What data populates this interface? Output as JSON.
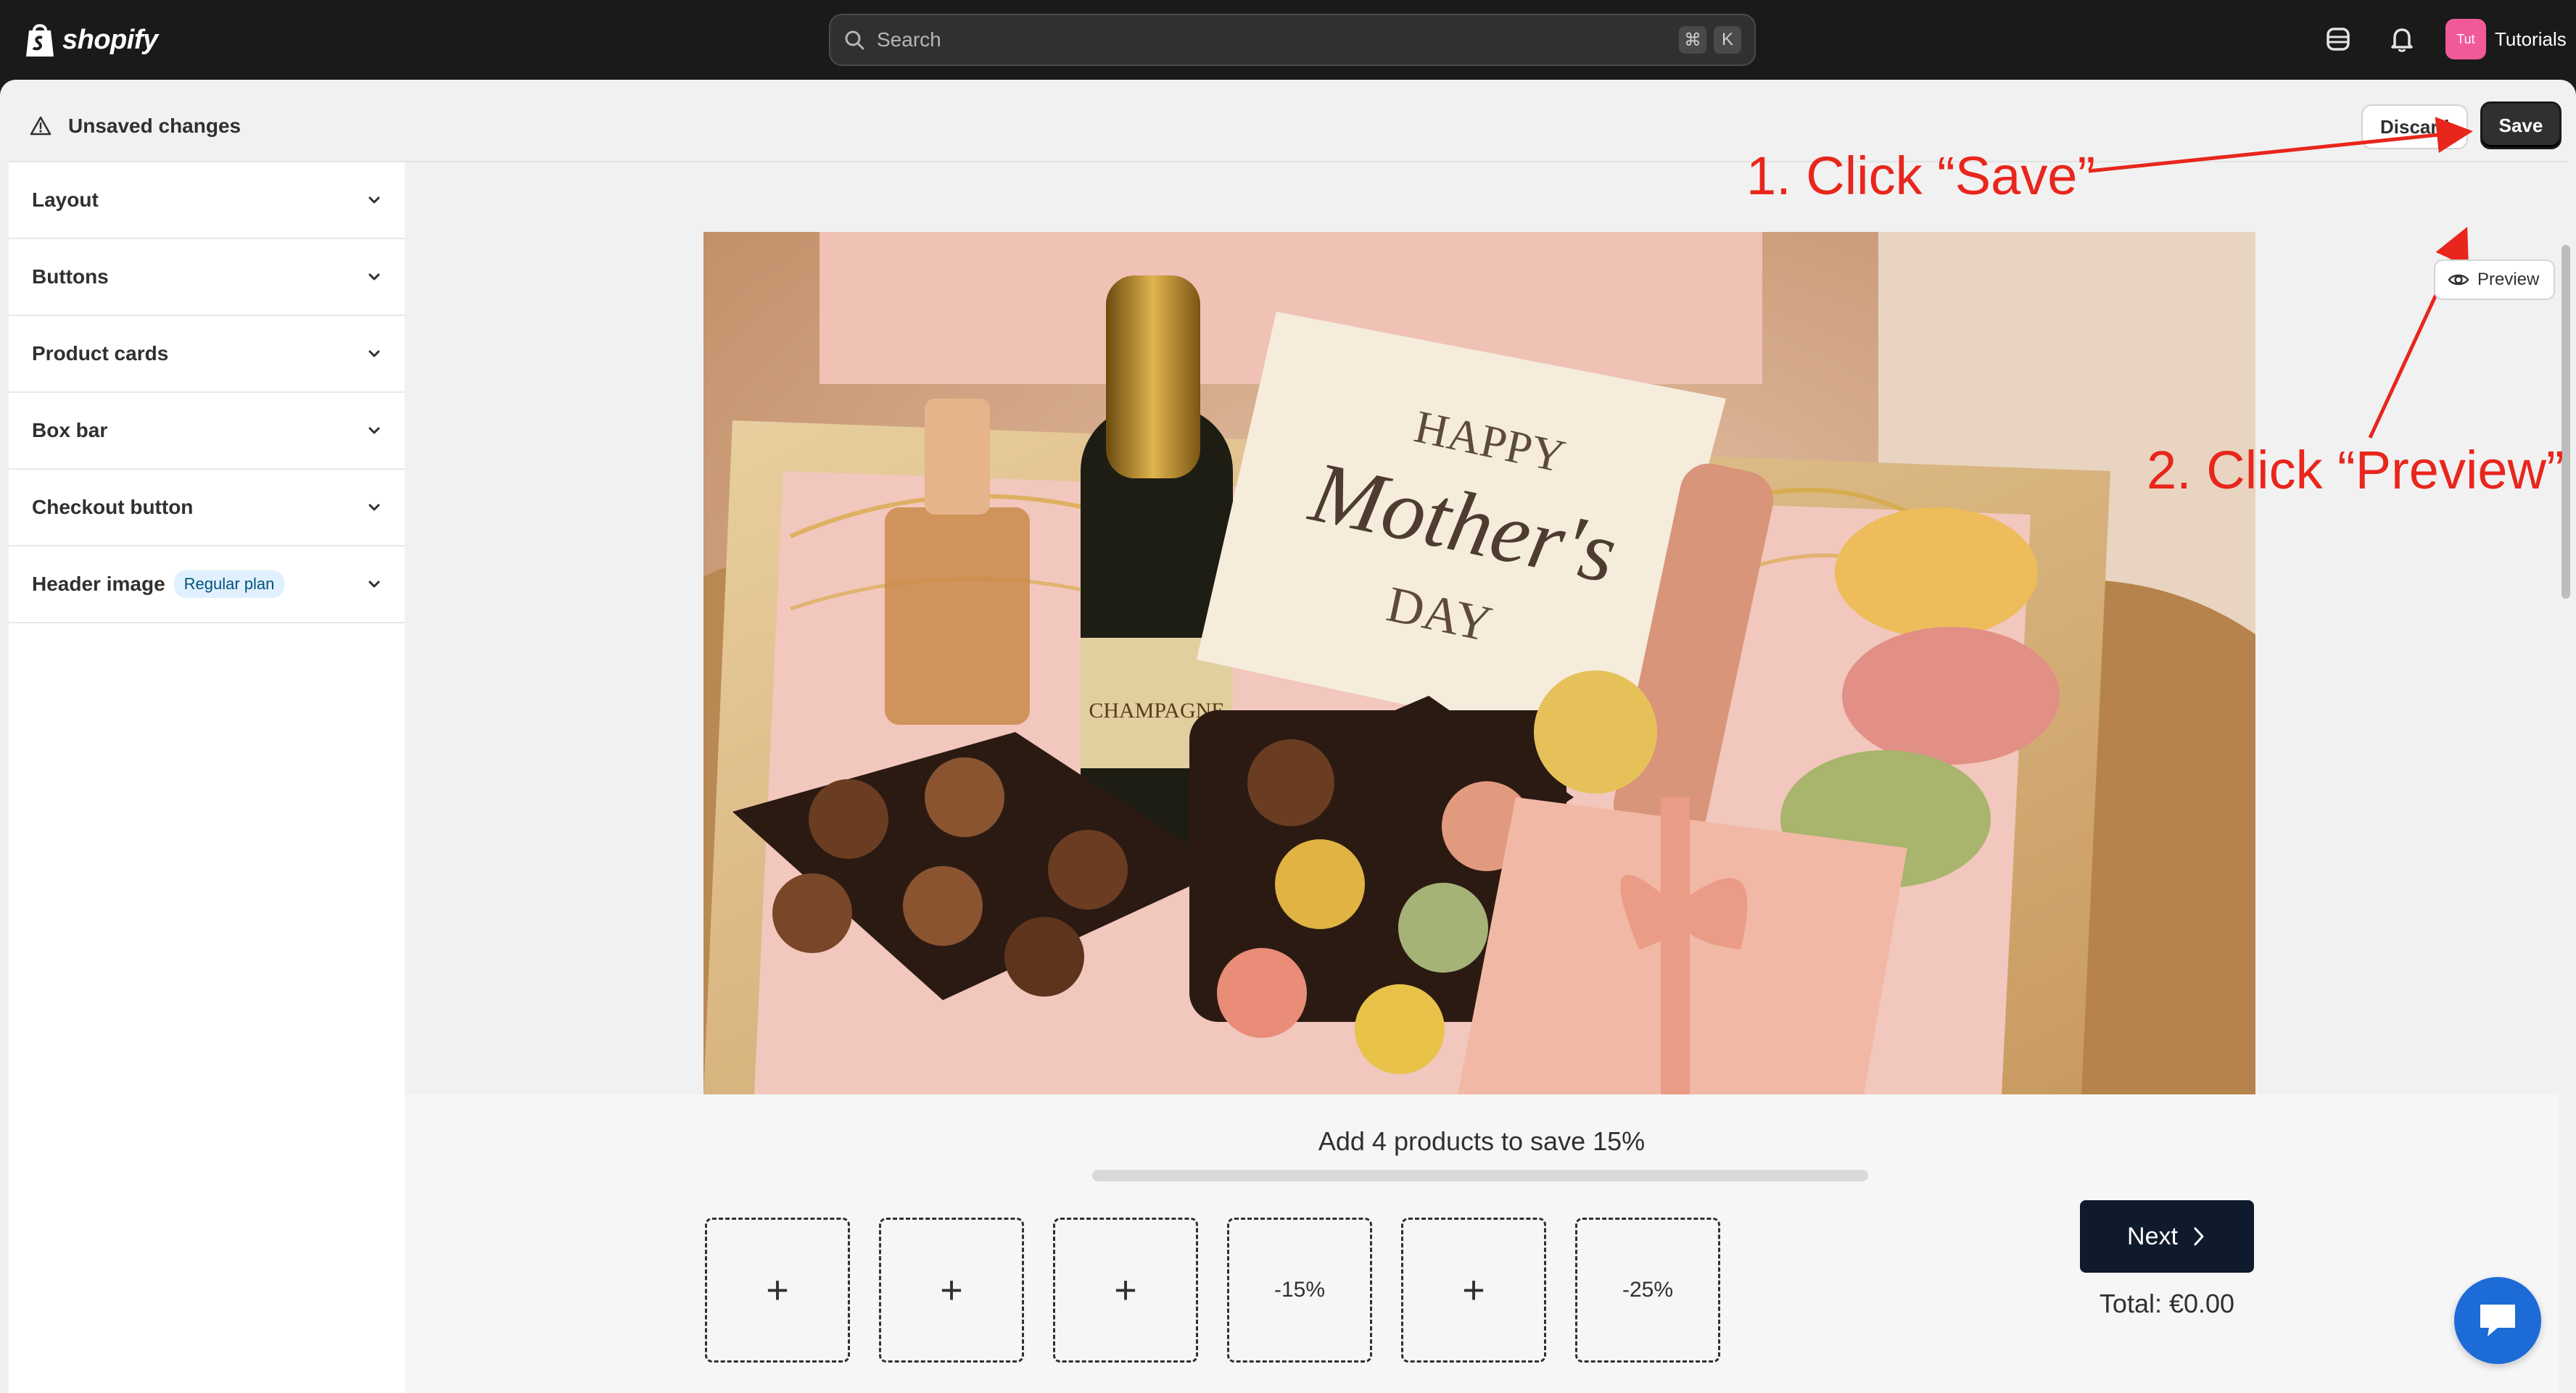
{
  "topbar": {
    "logo_text": "shopify",
    "search_placeholder": "Search",
    "shortcut_keys": [
      "⌘",
      "K"
    ],
    "user_initials": "Tut",
    "user_name": "Tutorials"
  },
  "savebar": {
    "status": "Unsaved changes",
    "discard_label": "Discard",
    "save_label": "Save"
  },
  "sidebar": {
    "items": [
      {
        "label": "Layout"
      },
      {
        "label": "Buttons"
      },
      {
        "label": "Product cards"
      },
      {
        "label": "Box bar"
      },
      {
        "label": "Checkout button"
      },
      {
        "label": "Header image",
        "badge": "Regular plan"
      }
    ]
  },
  "canvas": {
    "preview_label": "Preview",
    "hero_card": {
      "line1": "HAPPY",
      "line2": "Mother's",
      "line3": "DAY",
      "bottle_label": "CHAMPAGNE"
    },
    "progress_text": "Add 4 products to save 15%",
    "progress_fraction": 0.0,
    "slots": [
      "+",
      "+",
      "+",
      "-15%",
      "+",
      "-25%"
    ],
    "next_label": "Next",
    "total": "Total: €0.00"
  },
  "annotations": {
    "step1": "1. Click “Save”",
    "step2": "2. Click “Preview”"
  },
  "colors": {
    "topbar": "#1a1a1a",
    "annotation": "#e8261c",
    "next_button": "#0f1a2c",
    "chat": "#1c6bd6",
    "avatar": "#f15a9a"
  }
}
